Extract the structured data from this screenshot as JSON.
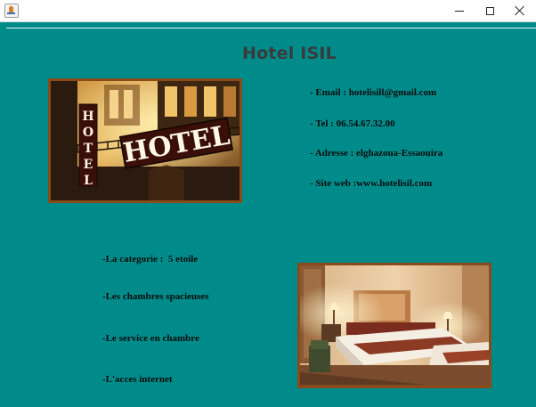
{
  "window": {
    "title": "",
    "icon": "java-app-icon",
    "controls": {
      "minimize": "minimize-icon",
      "maximize": "maximize-icon",
      "close": "close-icon"
    }
  },
  "page": {
    "background": "#008b8b",
    "title": "Hotel ISIL",
    "title_color": "#3a3a3a"
  },
  "contact": {
    "email": "- Email : hotelisill@gmail.com",
    "tel": "- Tel : 06.54.67.32.00",
    "address": "- Adresse : elghazoua-Essaouira",
    "website": "- Site web :www.hotelisil.com"
  },
  "features": [
    "-La categorie :  5 etoile",
    "-Les chambres spacieuses",
    "-Le service en chambre",
    "-L'acces internet"
  ],
  "images": {
    "hotel_sign": {
      "label": "hotel-facade-photo",
      "sign_text": "HOTEL",
      "frame_color": "#8a4a19"
    },
    "room": {
      "label": "hotel-room-photo",
      "frame_color": "#8a4a19"
    }
  }
}
